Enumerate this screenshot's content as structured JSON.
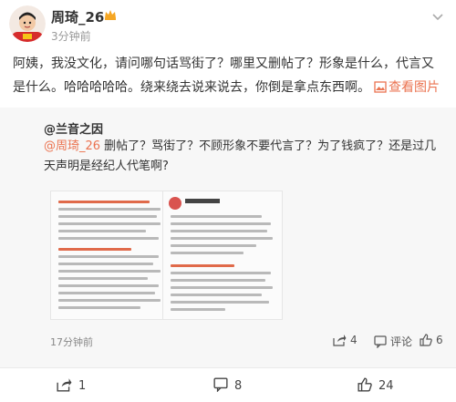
{
  "post": {
    "username": "周琦_26",
    "timestamp": "3分钟前",
    "body": "阿姨，我没文化，请问哪句话骂街了？哪里又删帖了？形象是什么，代言又是什么。哈哈哈哈哈。绕来绕去说来说去，你倒是拿点东西啊。",
    "view_image_label": "查看图片"
  },
  "repost": {
    "author": "@兰音之因",
    "mention": "@周琦_26",
    "text": " 删帖了？骂街了？不顾形象不要代言了？为了钱疯了？还是过几天声明是经纪人代笔啊?",
    "time": "17分钟前",
    "shares": "4",
    "comment_label": "评论",
    "likes": "6",
    "thumb_2_name": "周琦_26"
  },
  "footer": {
    "shares": "1",
    "comments": "8",
    "likes": "24"
  },
  "colors": {
    "accent": "#eb7350",
    "background": "#ffffff",
    "repost_background": "#f7f7f7"
  }
}
